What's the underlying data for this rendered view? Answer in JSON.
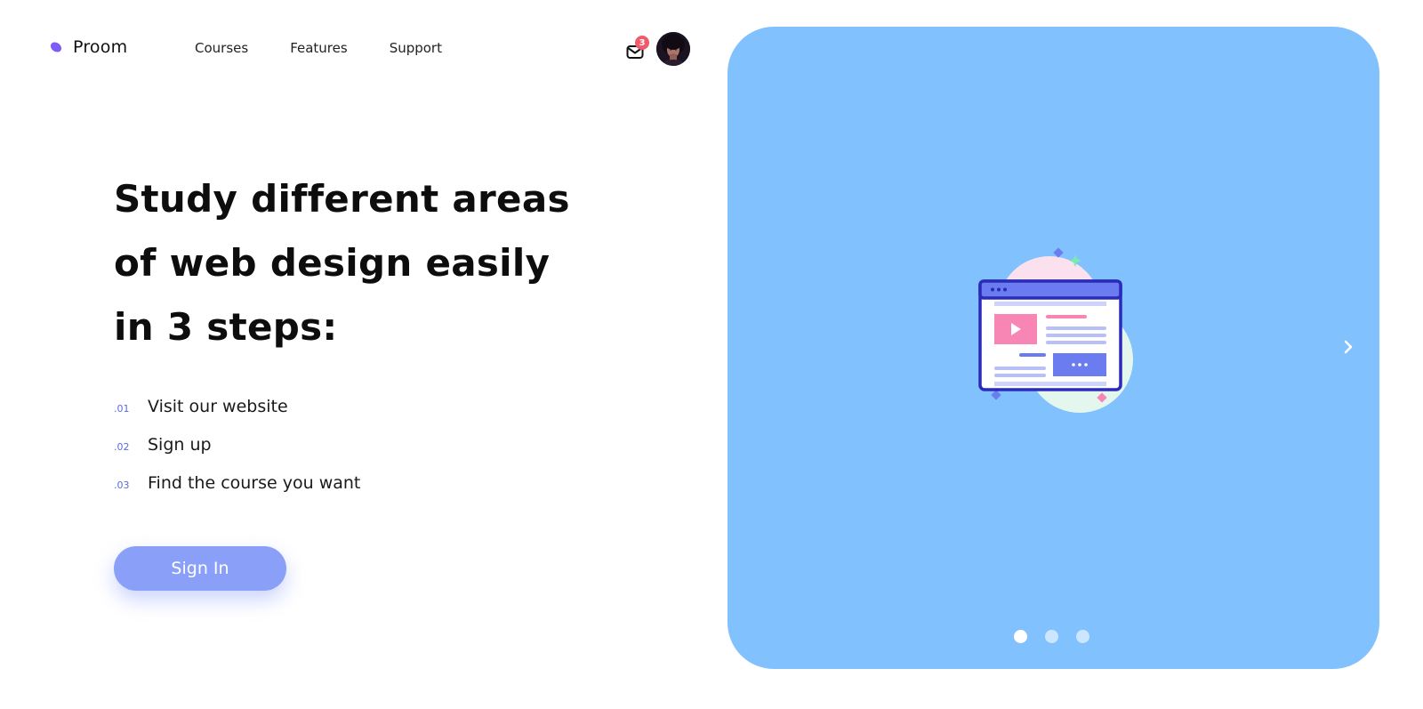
{
  "brand": {
    "name": "Proom",
    "colors": {
      "accent": "#8a9ff8",
      "panel": "#80c1fe",
      "badge": "#f05a6a",
      "logo": "#7c5cf5"
    }
  },
  "nav": {
    "items": [
      {
        "label": "Courses"
      },
      {
        "label": "Features"
      },
      {
        "label": "Support"
      }
    ]
  },
  "header": {
    "notifications_count": "3",
    "mail_icon": "mail-icon",
    "avatar": "user-avatar"
  },
  "hero": {
    "title": "Study different areas of web design easily in 3 steps:",
    "steps": [
      {
        "num": ".01",
        "text": "Visit our website"
      },
      {
        "num": ".02",
        "text": "Sign up"
      },
      {
        "num": ".03",
        "text": "Find the course you want"
      }
    ],
    "cta_label": "Sign In"
  },
  "carousel": {
    "slide_count": 3,
    "active_index": 0,
    "next_icon": "chevron-right-icon"
  }
}
